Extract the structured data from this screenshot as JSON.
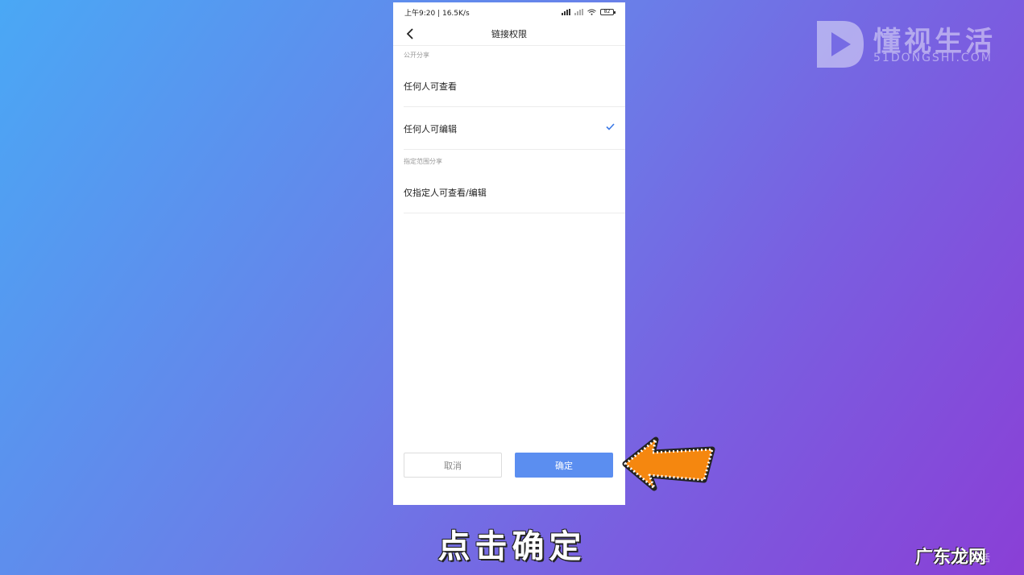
{
  "status_bar": {
    "time_speed": "上午9:20 | 16.5K/s",
    "battery": "82"
  },
  "nav": {
    "title": "链接权限"
  },
  "sections": {
    "public_label": "公开分享",
    "scoped_label": "指定范围分享"
  },
  "options": {
    "anyone_view": "任何人可查看",
    "anyone_edit": "任何人可编辑",
    "specified": "仅指定人可查看/编辑"
  },
  "buttons": {
    "cancel": "取消",
    "confirm": "确定"
  },
  "caption": "点击确定",
  "logo": {
    "name": "懂视生活",
    "sub": "51DONGSHI.COM"
  },
  "corner_watermark": {
    "name": "广东龙网",
    "sub": "生活"
  },
  "colors": {
    "accent": "#5b8ef0",
    "arrow": "#f5870f"
  }
}
